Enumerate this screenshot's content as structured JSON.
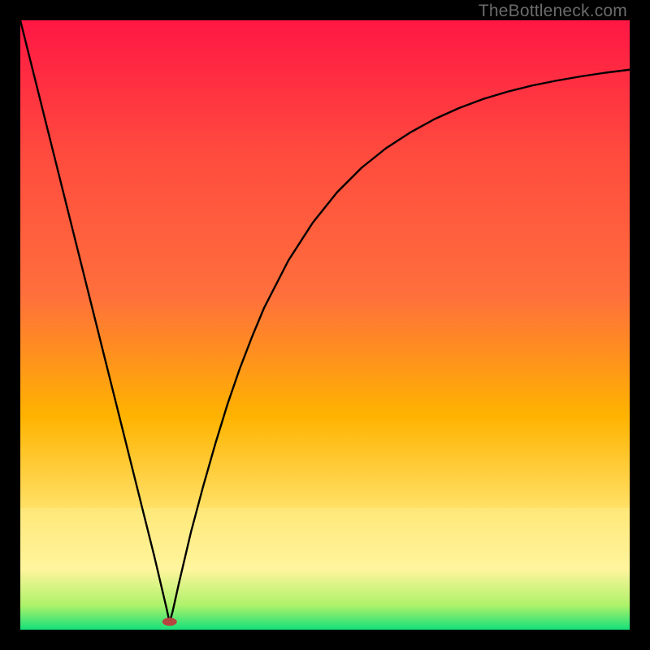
{
  "watermark": "TheBottleneck.com",
  "chart_data": {
    "type": "line",
    "title": "",
    "xlabel": "",
    "ylabel": "",
    "xlim": [
      0,
      100
    ],
    "ylim": [
      0,
      100
    ],
    "grid": false,
    "legend": false,
    "background_gradient": {
      "top": "#ff1744",
      "upper_mid": "#ff6f3c",
      "mid": "#ffb300",
      "lower_mid": "#ffe066",
      "band": "#fff59d",
      "near_bottom": "#aef26a",
      "bottom": "#14e07a"
    },
    "marker": {
      "x": 24.5,
      "y": 1.3,
      "color": "#b6453f",
      "rx": 9,
      "ry": 5
    },
    "series": [
      {
        "name": "curve",
        "x": [
          0,
          2,
          4,
          6,
          8,
          10,
          12,
          14,
          16,
          18,
          20,
          22,
          24,
          24.5,
          25,
          26,
          28,
          30,
          32,
          34,
          36,
          38,
          40,
          44,
          48,
          52,
          56,
          60,
          64,
          68,
          72,
          76,
          80,
          84,
          88,
          92,
          96,
          100
        ],
        "values": [
          100,
          92,
          84,
          76,
          68,
          60,
          52,
          44,
          36,
          28,
          20,
          12,
          3.5,
          1.2,
          3.0,
          7.5,
          16.0,
          23.5,
          30.5,
          37.0,
          42.8,
          48.0,
          52.8,
          60.6,
          66.8,
          71.8,
          75.8,
          79.0,
          81.6,
          83.8,
          85.6,
          87.1,
          88.3,
          89.3,
          90.1,
          90.8,
          91.4,
          91.9
        ]
      }
    ]
  }
}
